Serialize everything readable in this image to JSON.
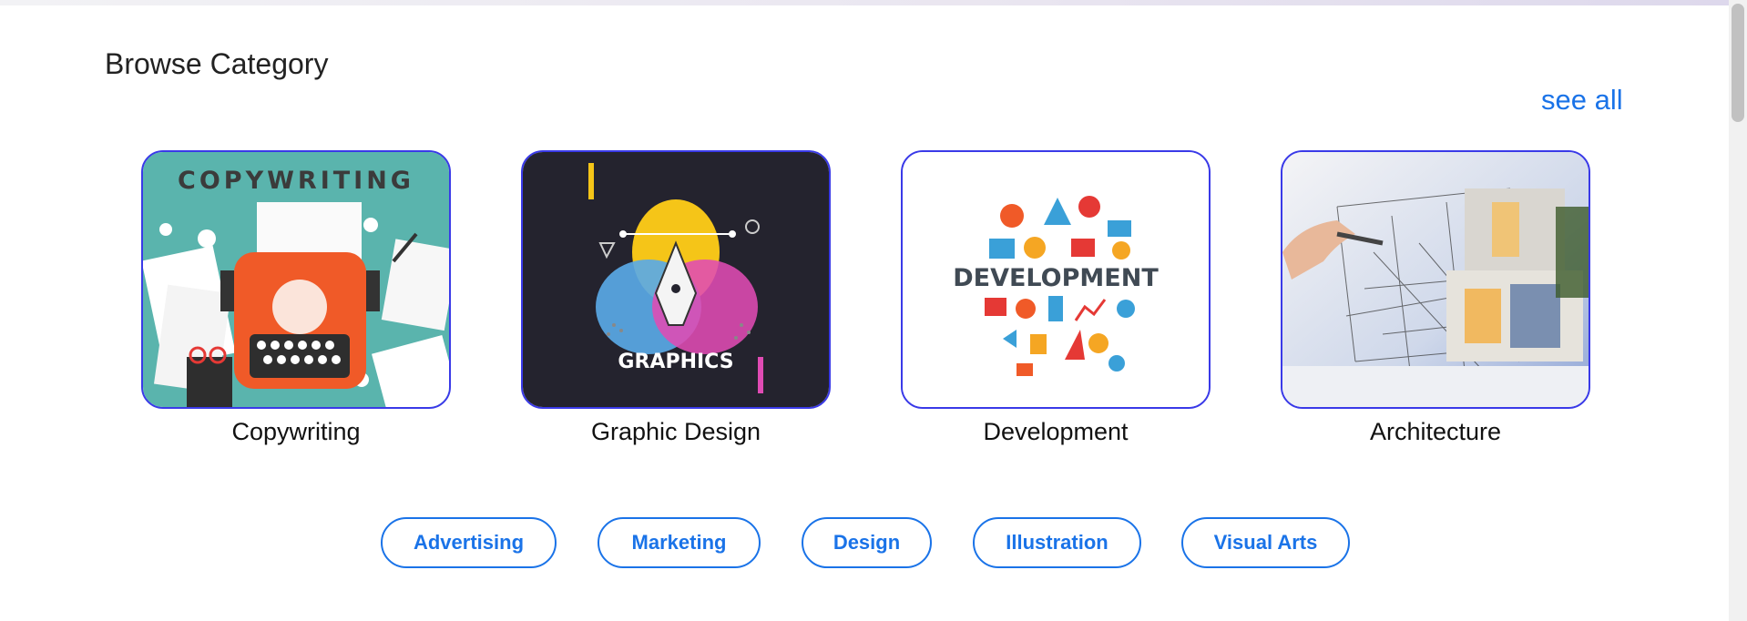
{
  "section": {
    "title": "Browse Category",
    "see_all": "see all"
  },
  "categories": [
    {
      "label": "Copywriting",
      "image_text": "COPYWRITING"
    },
    {
      "label": "Graphic Design",
      "image_text": "GRAPHICS"
    },
    {
      "label": "Development",
      "image_text": "DEVELOPMENT"
    },
    {
      "label": "Architecture"
    }
  ],
  "tags": [
    "Advertising",
    "Marketing",
    "Design",
    "Illustration",
    "Visual Arts"
  ],
  "colors": {
    "accent": "#1a73e8",
    "card_border": "#3a3ae8"
  }
}
